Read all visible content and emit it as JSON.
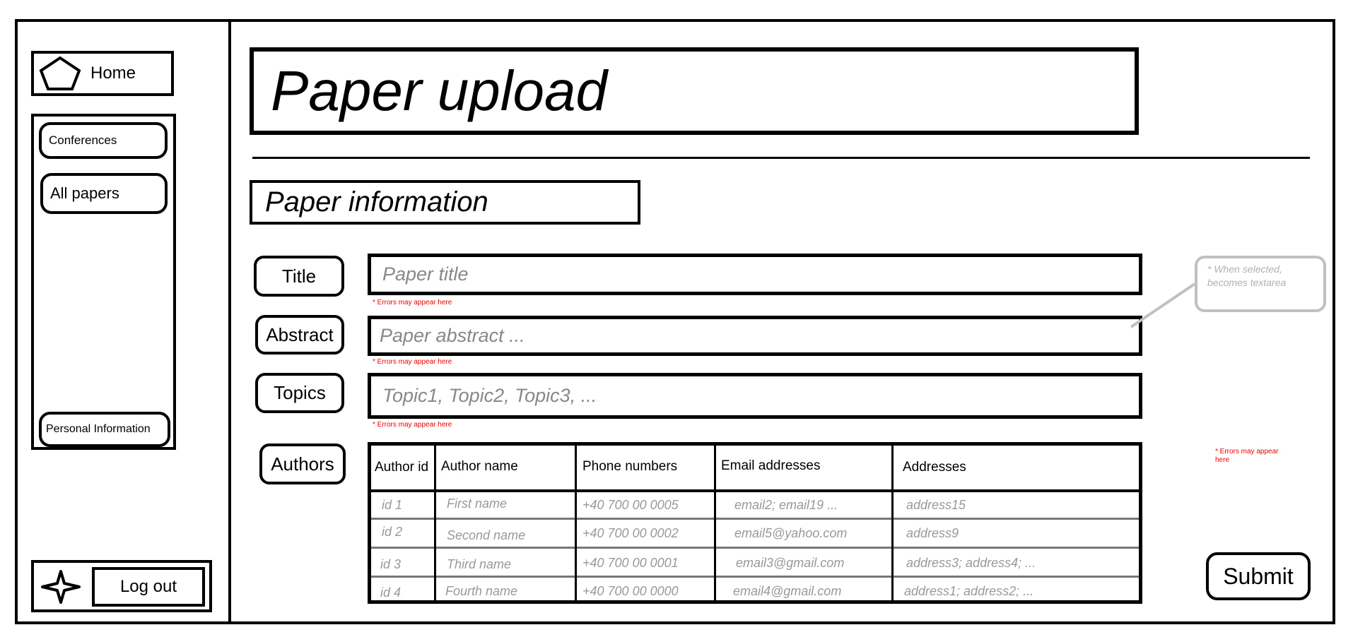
{
  "sidebar": {
    "home_label": "Home",
    "items": [
      {
        "label": "Conferences"
      },
      {
        "label": "All papers"
      },
      {
        "label": "Personal Information"
      }
    ],
    "logout_label": "Log out"
  },
  "main": {
    "title": "Paper upload",
    "section_title": "Paper information",
    "fields": {
      "title": {
        "label": "Title",
        "placeholder": "Paper title",
        "error": "* Errors may appear here"
      },
      "abstract": {
        "label": "Abstract",
        "placeholder": "Paper abstract ...",
        "error": "* Errors may appear here"
      },
      "topics": {
        "label": "Topics",
        "placeholder": "Topic1, Topic2, Topic3, ...",
        "error": "* Errors may appear here"
      }
    },
    "abstract_note": "* When selected, becomes textarea",
    "authors": {
      "label": "Authors",
      "columns": [
        "Author id",
        "Author name",
        "Phone numbers",
        "Email addresses",
        "Addresses"
      ],
      "rows": [
        [
          "id 1",
          "First name",
          "+40 700 00 0005",
          "email2; email19 ...",
          "address15"
        ],
        [
          "id 2",
          "Second name",
          "+40 700 00 0002",
          "email5@yahoo.com",
          "address9"
        ],
        [
          "id 3",
          "Third name",
          "+40 700 00 0001",
          "email3@gmail.com",
          "address3; address4; ..."
        ],
        [
          "id 4",
          "Fourth name",
          "+40 700 00 0000",
          "email4@gmail.com",
          "address1; address2; ..."
        ]
      ],
      "error": "* Errors may appear here"
    },
    "submit_label": "Submit"
  },
  "colors": {
    "error": "#e00000",
    "placeholder": "#888888",
    "note_border": "#c0c0c0"
  },
  "icons": {
    "home": "pentagon-icon",
    "logout": "four-point-star-icon"
  }
}
